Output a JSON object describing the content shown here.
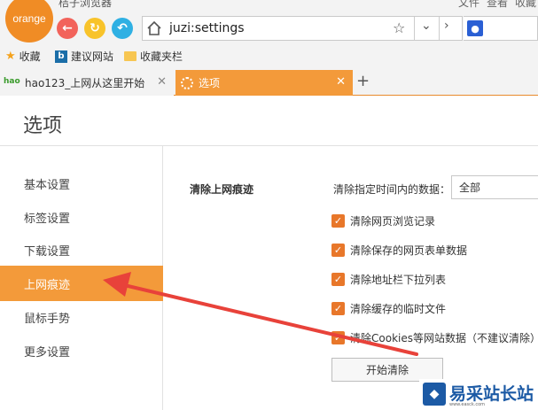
{
  "app": {
    "logo_text": "orange",
    "title": "桔子浏览器"
  },
  "top_menu": [
    "文件",
    "查看",
    "收藏"
  ],
  "address_bar": {
    "url": "juzi:settings"
  },
  "bookmarks": [
    {
      "label": "收藏",
      "icon": "star-icon"
    },
    {
      "label": "建议网站",
      "icon": "bing-icon"
    },
    {
      "label": "收藏夹栏",
      "icon": "folder-icon"
    }
  ],
  "tabs": [
    {
      "label": "hao123_上网从这里开始",
      "active": false
    },
    {
      "label": "选项",
      "active": true
    }
  ],
  "page": {
    "title": "选项"
  },
  "sidebar": {
    "items": [
      {
        "label": "基本设置",
        "active": false
      },
      {
        "label": "标签设置",
        "active": false
      },
      {
        "label": "下载设置",
        "active": false
      },
      {
        "label": "上网痕迹",
        "active": true
      },
      {
        "label": "鼠标手势",
        "active": false
      },
      {
        "label": "更多设置",
        "active": false
      }
    ]
  },
  "clear_section": {
    "title": "清除上网痕迹",
    "time_label": "清除指定时间内的数据：",
    "time_value": "全部",
    "options": [
      {
        "label": "清除网页浏览记录",
        "checked": true
      },
      {
        "label": "清除保存的网页表单数据",
        "checked": true
      },
      {
        "label": "清除地址栏下拉列表",
        "checked": true
      },
      {
        "label": "清除缓存的临时文件",
        "checked": true
      },
      {
        "label": "清除Cookies等网站数据（不建议清除）",
        "checked": true
      }
    ],
    "start_button": "开始清除"
  },
  "watermark": {
    "text": "易采站长站",
    "sub": "www.easck.com"
  },
  "colors": {
    "accent": "#f39a3a",
    "arrow": "#e8423a",
    "checkbox": "#e8772a"
  }
}
